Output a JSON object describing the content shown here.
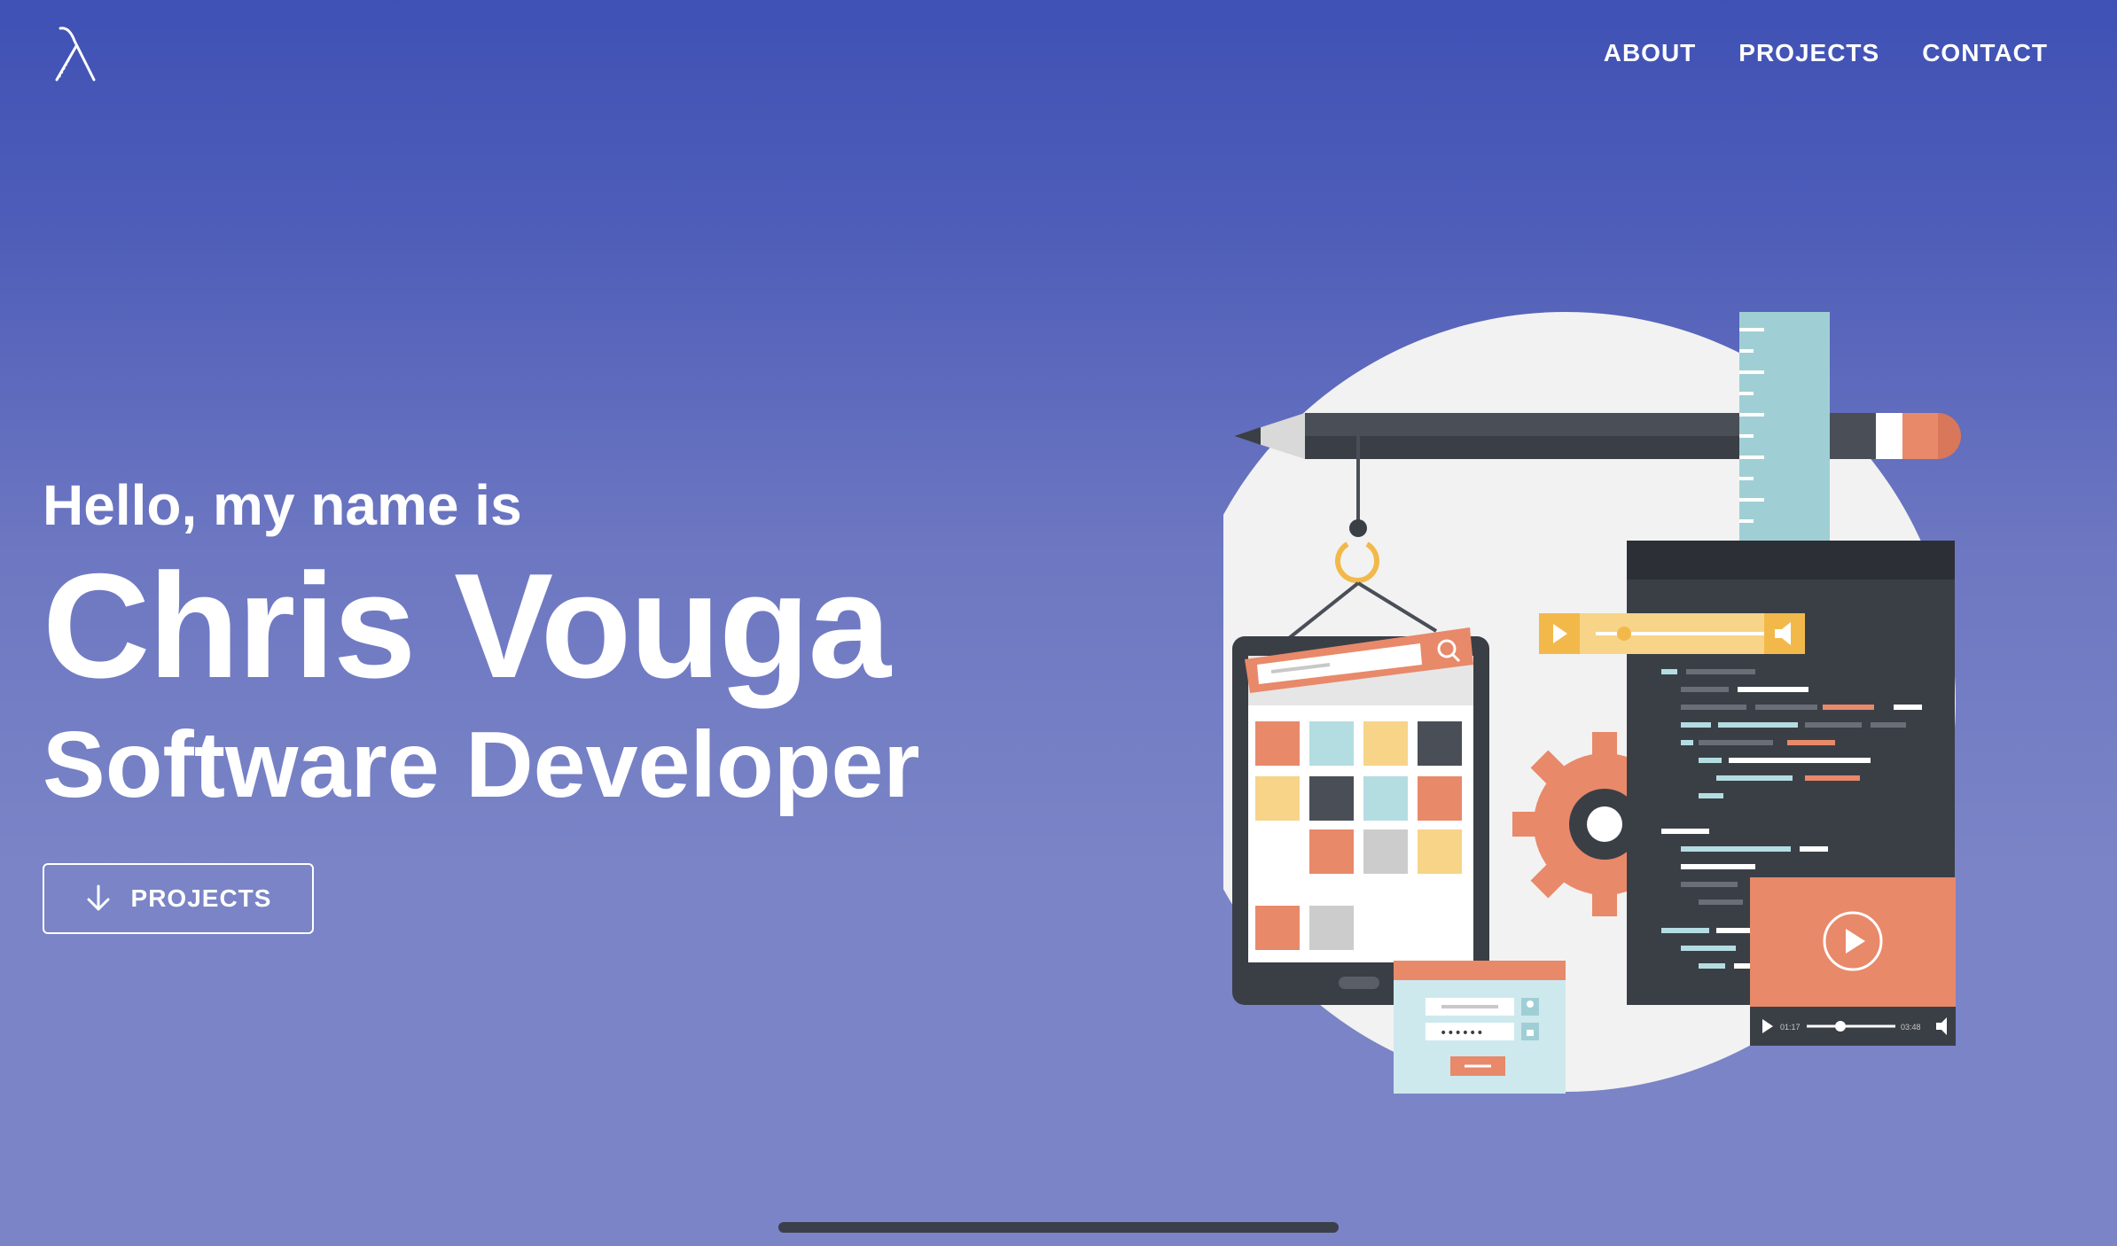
{
  "brand": {
    "logo_icon": "lambda-logo-icon"
  },
  "nav": {
    "items": [
      {
        "label": "ABOUT"
      },
      {
        "label": "PROJECTS"
      },
      {
        "label": "CONTACT"
      }
    ]
  },
  "hero": {
    "greeting": "Hello, my name is",
    "name": "Chris Vouga",
    "role": "Software Developer",
    "cta_label": "PROJECTS",
    "cta_icon": "arrow-down-icon"
  },
  "illustration": {
    "video_player": {
      "current_time": "01:17",
      "total_time": "03:48"
    },
    "login_password_mask": "••••••"
  },
  "colors": {
    "background_top": "#3f51b5",
    "background_bottom": "#7a84c6",
    "accent_orange": "#e8896a",
    "accent_yellow": "#f7d488",
    "accent_teal": "#b4dde2",
    "dark_slate": "#3a3f46"
  }
}
